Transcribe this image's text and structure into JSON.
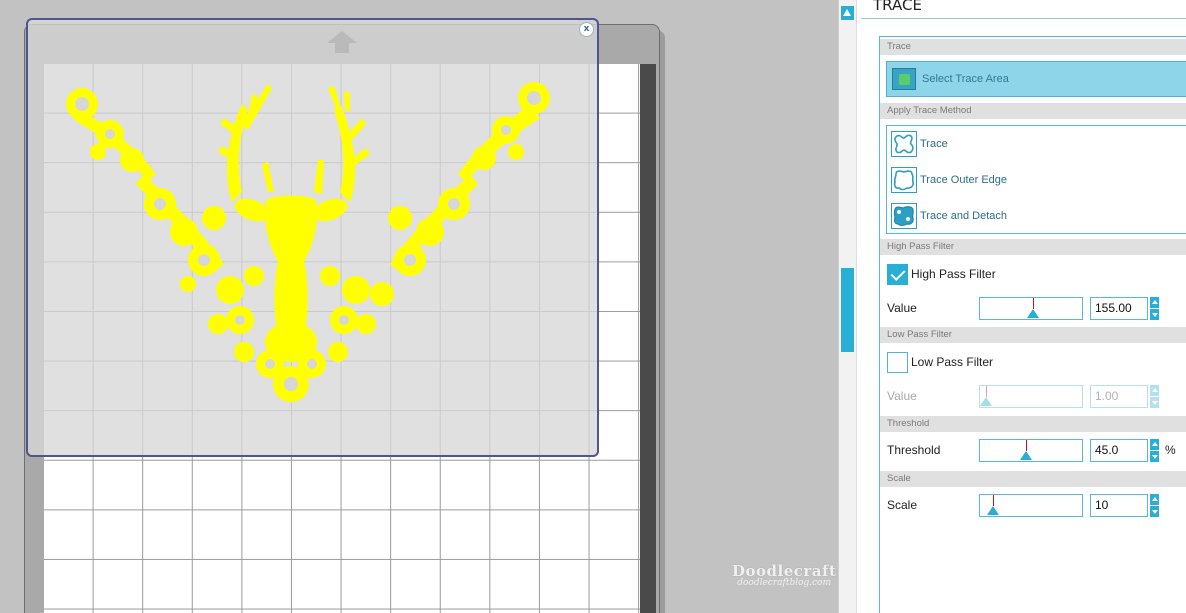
{
  "canvas": {
    "design_color": "#ffff00",
    "close_label": "x",
    "watermark": {
      "line1": "Doodlecraft",
      "line2": "doodlecraftblog.com"
    }
  },
  "panel": {
    "title": "TRACE",
    "sections": {
      "trace": {
        "header": "Trace",
        "select_button": {
          "label": "Select Trace Area",
          "icon": "select-trace-area-icon"
        }
      },
      "apply_method": {
        "header": "Apply Trace Method",
        "items": [
          {
            "label": "Trace",
            "icon": "trace-icon"
          },
          {
            "label": "Trace Outer Edge",
            "icon": "trace-outer-edge-icon"
          },
          {
            "label": "Trace and Detach",
            "icon": "trace-detach-icon"
          }
        ]
      },
      "high_pass": {
        "header": "High Pass Filter",
        "checkbox_label": "High Pass Filter",
        "checked": true,
        "value_label": "Value",
        "value": "155.00",
        "slider_fraction": 0.52
      },
      "low_pass": {
        "header": "Low Pass Filter",
        "checkbox_label": "Low Pass Filter",
        "checked": false,
        "value_label": "Value",
        "value": "1.00",
        "slider_fraction": 0.02
      },
      "threshold": {
        "header": "Threshold",
        "label": "Threshold",
        "value": "45.0",
        "unit": "%",
        "slider_fraction": 0.45
      },
      "scale": {
        "header": "Scale",
        "label": "Scale",
        "value": "10",
        "slider_fraction": 0.1
      }
    }
  },
  "colors": {
    "accent": "#29aed5",
    "select_fill": "#8fd5ea",
    "slider_mark": "#d0102a",
    "trace_border": "#4e5590"
  }
}
